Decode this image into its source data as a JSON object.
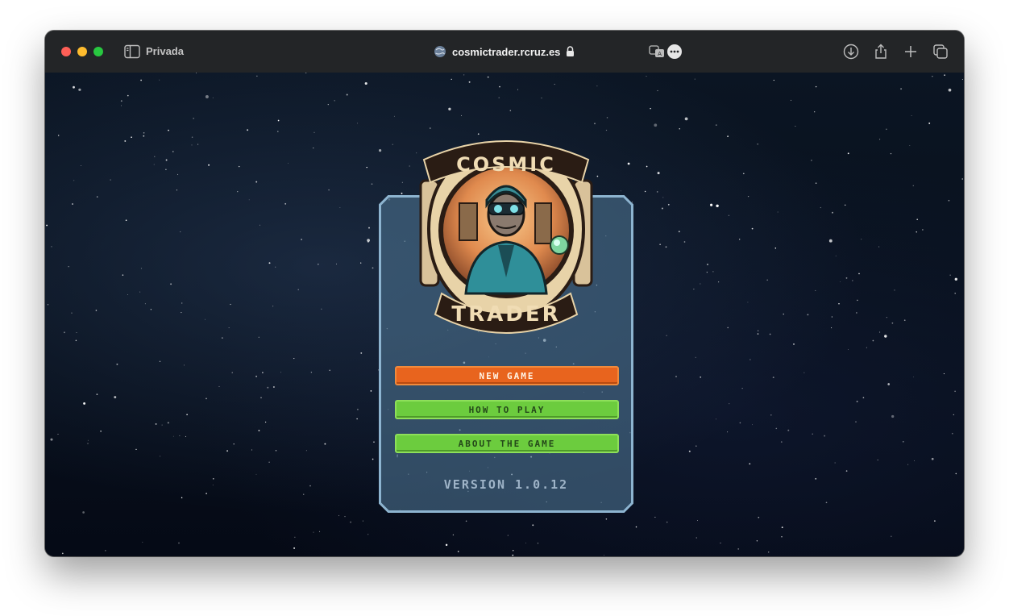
{
  "browser": {
    "mode_label": "Privada",
    "url": "cosmictrader.rcruz.es"
  },
  "logo": {
    "top_text": "COSMIC",
    "bottom_text": "TRADER"
  },
  "menu": {
    "new_game": "NEW GAME",
    "how_to_play": "HOW TO PLAY",
    "about": "ABOUT THE GAME"
  },
  "version": "VERSION 1.0.12",
  "colors": {
    "new_game_button": "#e8641e",
    "secondary_buttons": "#6ccc3e",
    "panel": "#4a708c",
    "panel_border": "#8db4d0"
  },
  "icons": {
    "sidebar": "sidebar-icon",
    "site": "globe-icon",
    "lock": "lock-icon",
    "translate": "translate-icon",
    "more": "more-icon",
    "download": "download-icon",
    "share": "share-icon",
    "new_tab": "plus-icon",
    "tabs": "tabs-overview-icon"
  }
}
